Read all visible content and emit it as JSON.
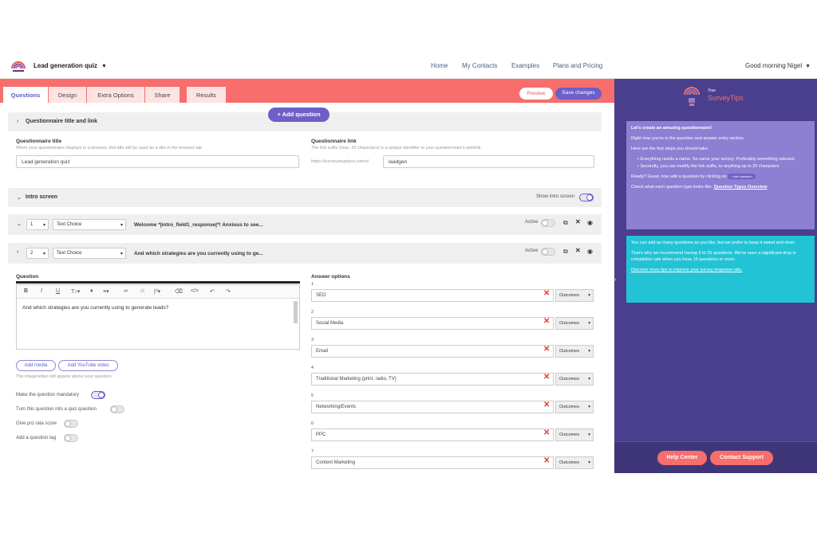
{
  "header": {
    "quiz_name": "Lead generation quiz",
    "nav": [
      "Home",
      "My Contacts",
      "Examples",
      "Plans and Pricing"
    ],
    "greeting": "Good morning Nigel"
  },
  "tabs": [
    "Questions",
    "Design",
    "Extra Options",
    "Share",
    "Results"
  ],
  "toolbar": {
    "preview_label": "Preview",
    "save_label": "Save changes",
    "add_question_label": "+ Add question"
  },
  "section_title": {
    "label": "Questionnaire title and link",
    "title_label": "Questionnaire title",
    "title_hint": "When your questionnaire displays in a browser, this title will be used as a title in the browser tab",
    "title_value": "Lead generation quiz",
    "link_label": "Questionnaire link",
    "link_hint": "The link suffix (max. 20 characters) is a unique identifier to your questionnaire's weblink",
    "link_prefix": "https://surveyanyplace.com/s/",
    "link_value": "leadgen"
  },
  "intro": {
    "label": "Intro screen",
    "show_label": "Show intro screen"
  },
  "questions": [
    {
      "number": "1",
      "type": "Text Choice",
      "title": "Welcome *|intro_field1_response|*! Anxious to see...",
      "active_label": "Active"
    },
    {
      "number": "2",
      "type": "Text Choice",
      "title": "And which strategies are you currently using to ge...",
      "active_label": "Active"
    }
  ],
  "editor": {
    "question_label": "Question",
    "text": "And which strategies are you currently using to generate leads?",
    "add_media": "Add media",
    "add_youtube": "Add YouTube video",
    "media_hint": "The image/video will appear above your question",
    "mandatory": "Make the question mandatory",
    "quiz": "Turn this question into a quiz question",
    "pro_rata": "Give pro rata score",
    "tag": "Add a question tag"
  },
  "answers": {
    "label": "Answer options",
    "outcomes_label": "Outcomes",
    "options": [
      {
        "n": "1",
        "text": "SEO"
      },
      {
        "n": "2",
        "text": "Social Media"
      },
      {
        "n": "3",
        "text": "Email"
      },
      {
        "n": "4",
        "text": "Traditional Marketing (print, radio, TV)"
      },
      {
        "n": "5",
        "text": "Networking/Events"
      },
      {
        "n": "6",
        "text": "PPC"
      },
      {
        "n": "7",
        "text": "Content Marketing"
      }
    ]
  },
  "sidebar": {
    "logo_small": "Your",
    "logo_big": "SurveyTips",
    "tip1": {
      "heading": "Let's create an amazing questionnaire!",
      "p1": "Right now you're in the question and answer entry section.",
      "p2": "Here are the first steps you should take:",
      "b1": "Everything needs a name. So name your survey. Preferably something relevant.",
      "b2": "Secondly, you can modify the link suffix, to anything up to 20 characters",
      "p3": "Ready? Great, now add a question by clicking on",
      "p3_badge": "+ Add question",
      "p4": "Check what each question type looks like.",
      "p4_link": "Question Types Overview"
    },
    "tip2": {
      "p1": "You can add as many questions as you like, but we prefer to keep it sweet and short.",
      "p2": "That's why we recommend having 5 to 15 questions. We've seen a significant drop in completion rate when you have 15 questions or more.",
      "link": "Discover more tips to improve your survey response rate."
    },
    "help_center": "Help Center",
    "contact_support": "Contact Support"
  }
}
